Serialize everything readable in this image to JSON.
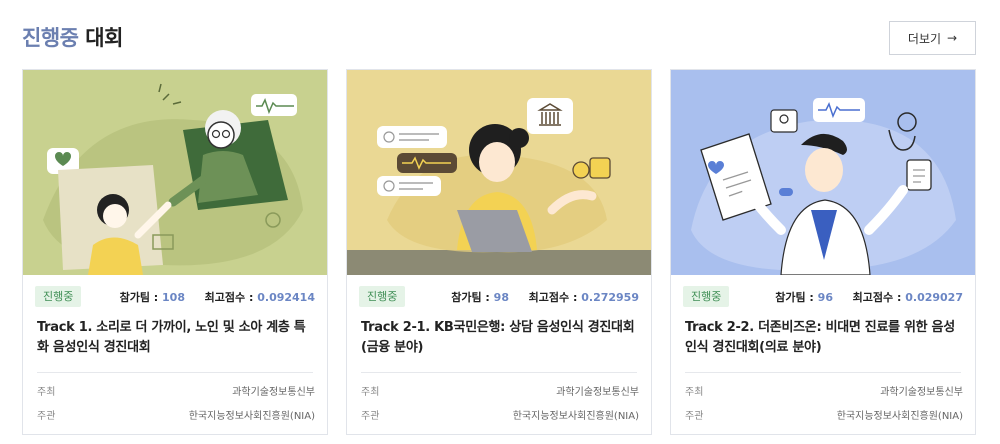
{
  "header": {
    "title_accent": "진행중",
    "title_rest": "대회",
    "more_label": "더보기",
    "more_icon": "arrow-right-icon"
  },
  "cards": [
    {
      "status": "진행중",
      "participants_label": "참가팀 :",
      "participants": "108",
      "best_label": "최고점수 :",
      "best_score": "0.092414",
      "title": "Track 1. 소리로 더 가까이, 노인 및 소아 계층 특화 음성인식 경진대회",
      "host_label": "주최",
      "host": "과학기술정보통신부",
      "organizer_label": "주관",
      "organizer": "한국지능정보사회진흥원(NIA)",
      "bg": "#c5cf8f"
    },
    {
      "status": "진행중",
      "participants_label": "참가팀 :",
      "participants": "98",
      "best_label": "최고점수 :",
      "best_score": "0.272959",
      "title": "Track 2-1. KB국민은행: 상담 음성인식 경진대회 (금융 분야)",
      "host_label": "주최",
      "host": "과학기술정보통신부",
      "organizer_label": "주관",
      "organizer": "한국지능정보사회진흥원(NIA)",
      "bg": "#ead894"
    },
    {
      "status": "진행중",
      "participants_label": "참가팀 :",
      "participants": "96",
      "best_label": "최고점수 :",
      "best_score": "0.029027",
      "title": "Track 2-2. 더존비즈온: 비대면 진료를 위한 음성인식 경진대회(의료 분야)",
      "host_label": "주최",
      "host": "과학기술정보통신부",
      "organizer_label": "주관",
      "organizer": "한국지능정보사회진흥원(NIA)",
      "bg": "#a9bfee"
    }
  ]
}
